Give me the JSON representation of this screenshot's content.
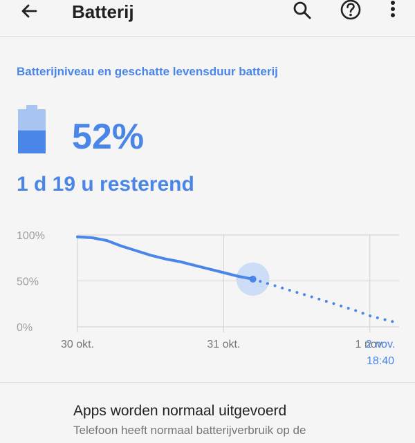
{
  "toolbar": {
    "title": "Batterij",
    "back_icon": "arrow-back-icon",
    "search_icon": "search-icon",
    "help_icon": "help-icon",
    "menu_icon": "more-vert-icon"
  },
  "battery": {
    "section_title": "Batterijniveau en geschatte levensduur batterij",
    "level_percent": "52%",
    "level_value": 52,
    "remaining": "1 d 19 u resterend",
    "icon": "battery-icon"
  },
  "chart_data": {
    "type": "line",
    "y_tick_labels": [
      "100%",
      "50%",
      "0%"
    ],
    "x_tick_labels": [
      "30 okt.",
      "31 okt.",
      "1 nov.",
      "2 nov."
    ],
    "end_label": [
      "2 nov.",
      "18:40"
    ],
    "ylim": [
      0,
      100
    ],
    "series": [
      {
        "values": [
          [
            0,
            98
          ],
          [
            0.1,
            97
          ],
          [
            0.2,
            94
          ],
          [
            0.3,
            88
          ],
          [
            0.4,
            83
          ],
          [
            0.5,
            78
          ],
          [
            0.6,
            74
          ],
          [
            0.7,
            71
          ],
          [
            0.8,
            67
          ],
          [
            0.9,
            63
          ],
          [
            1.0,
            59
          ],
          [
            1.1,
            55
          ],
          [
            1.2,
            52
          ]
        ],
        "style": "solid"
      },
      {
        "values": [
          [
            1.2,
            52
          ],
          [
            1.45,
            40
          ],
          [
            1.7,
            28
          ],
          [
            1.9,
            18
          ],
          [
            2.0,
            12
          ],
          [
            2.2,
            4
          ]
        ],
        "style": "dotted"
      }
    ],
    "x_domain": [
      0,
      2.2
    ],
    "grid": true,
    "colors": {
      "line": "#4a86e8",
      "grid": "#d0d0d0",
      "marker_halo": "#cddcf7"
    }
  },
  "status": {
    "title": "Apps worden normaal uitgevoerd",
    "description": "Telefoon heeft normaal batterijverbruik op de"
  },
  "colors": {
    "accent": "#4a86e8",
    "battery_light": "#a8c4f0",
    "background": "#f5f5f5"
  }
}
